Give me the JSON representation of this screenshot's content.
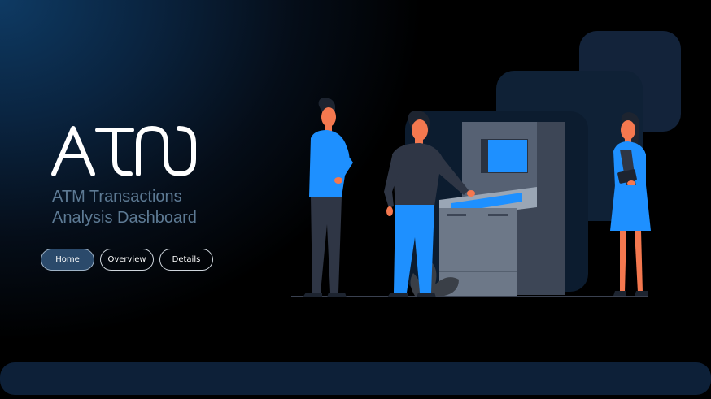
{
  "app": {
    "logo_text": "ATM",
    "subtitle_line1": "ATM Transactions",
    "subtitle_line2": "Analysis Dashboard"
  },
  "nav": {
    "home": "Home",
    "overview": "Overview",
    "details": "Details",
    "active": "Home"
  },
  "colors": {
    "accent": "#1e90ff",
    "background": "#000000",
    "panel": "#0d2038"
  }
}
